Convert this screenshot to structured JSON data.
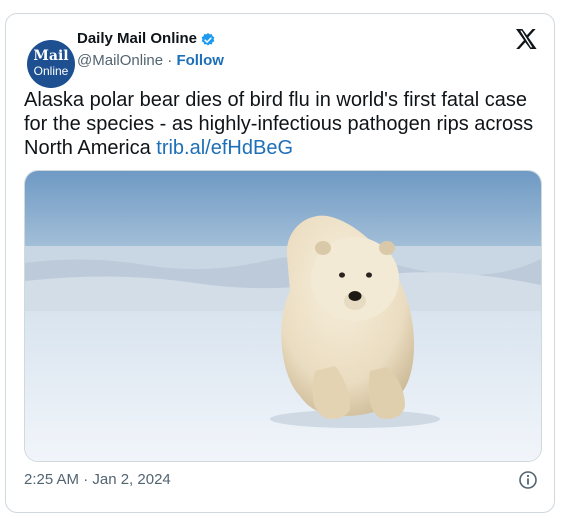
{
  "author": {
    "name": "Daily Mail Online",
    "handle": "@MailOnline",
    "separator": " · ",
    "follow_label": "Follow",
    "avatar_line1": "Mail",
    "avatar_line2": "Online",
    "verified_icon": "verified-badge-icon"
  },
  "tweet": {
    "text": "Alaska polar bear dies of bird flu in world's first fatal case for the species - as highly-infectious pathogen rips across North America ",
    "link_text": "trib.al/efHdBeG",
    "timestamp": "2:25 AM · Jan 2, 2024"
  },
  "media": {
    "subject": "polar bear walking on snow"
  },
  "icons": {
    "platform": "x-logo-icon",
    "info": "info-icon"
  },
  "colors": {
    "link": "#1d6fb8",
    "verified": "#1d9bf0",
    "muted": "#536471",
    "avatar_bg": "#1d4f91",
    "border": "#cfd9de"
  }
}
